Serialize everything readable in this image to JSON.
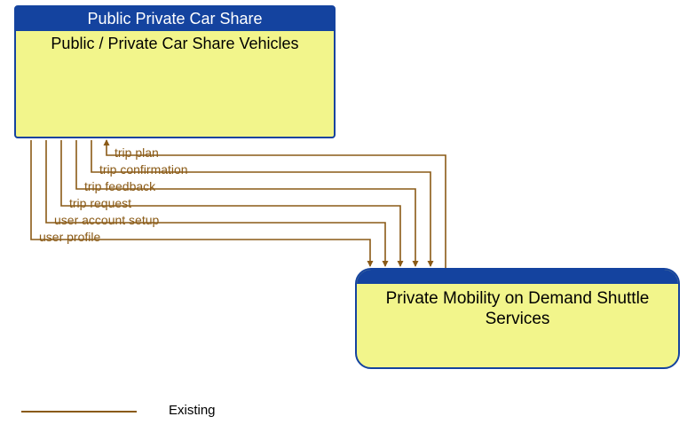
{
  "box1": {
    "header": "Public Private Car Share",
    "title": "Public / Private Car Share Vehicles"
  },
  "box2": {
    "title": "Private Mobility on Demand Shuttle Services"
  },
  "flows": {
    "f1": "trip plan",
    "f2": "trip confirmation",
    "f3": "trip feedback",
    "f4": "trip request",
    "f5": "user account setup",
    "f6": "user profile"
  },
  "legend": {
    "existing": "Existing"
  }
}
